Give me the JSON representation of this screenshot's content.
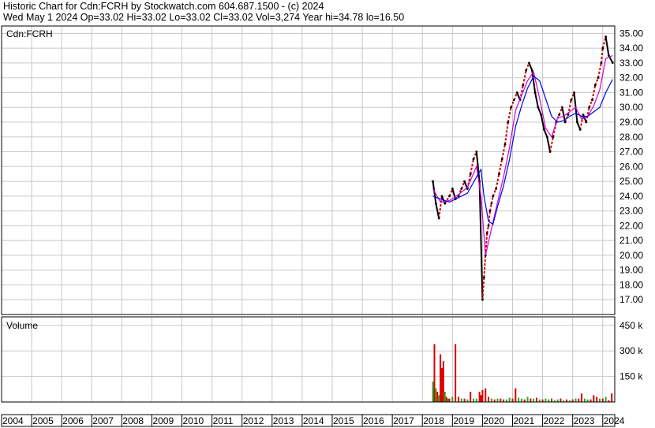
{
  "header": {
    "line1": "Historic Chart for Cdn:FCRH by Stockwatch.com 604.687.1500 - (c) 2024",
    "line2": "Wed May  1 2024   Op=33.02   Hi=33.02   Lo=33.02   Cl=33.02   Vol=3,274   Year hi=34.78   lo=16.50"
  },
  "price_panel": {
    "label": "Cdn:FCRH"
  },
  "volume_panel": {
    "label": "Volume"
  },
  "colors": {
    "grid": "#c8c8c8",
    "price_up": "#cc0000",
    "price_down": "#000000",
    "ma_short": "#d000d0",
    "ma_long": "#0000ee",
    "volume_up": "#dd0000",
    "volume_down": "#22aa22"
  },
  "chart_data": [
    {
      "type": "line",
      "title": "",
      "ylabel": "",
      "ylim": [
        16,
        35.5
      ],
      "y_ticks": [
        "17.00",
        "18.00",
        "19.00",
        "20.00",
        "21.00",
        "22.00",
        "23.00",
        "24.00",
        "25.00",
        "26.00",
        "27.00",
        "28.00",
        "29.00",
        "30.00",
        "31.00",
        "32.00",
        "33.00",
        "34.00",
        "35.00"
      ],
      "x_ticks": [
        "2004",
        "2005",
        "2006",
        "2007",
        "2008",
        "2009",
        "2010",
        "2011",
        "2012",
        "2013",
        "2014",
        "2015",
        "2016",
        "2017",
        "2018",
        "2019",
        "2020",
        "2021",
        "2022",
        "2023",
        "2024"
      ],
      "series": [
        {
          "x": [
            2018.35,
            2018.45,
            2018.55,
            2018.65,
            2018.75,
            2018.9,
            2019.0,
            2019.1,
            2019.2,
            2019.3,
            2019.4,
            2019.5,
            2019.6,
            2019.7,
            2019.8,
            2019.9,
            2020.0,
            2020.05,
            2020.1,
            2020.15,
            2020.2,
            2020.25,
            2020.3,
            2020.35,
            2020.45,
            2020.55,
            2020.65,
            2020.75,
            2020.85,
            2020.95,
            2021.05,
            2021.15,
            2021.25,
            2021.35,
            2021.45,
            2021.55,
            2021.65,
            2021.75,
            2021.85,
            2021.95,
            2022.05,
            2022.15,
            2022.25,
            2022.35,
            2022.45,
            2022.55,
            2022.65,
            2022.75,
            2022.85,
            2022.95,
            2023.05,
            2023.15,
            2023.25,
            2023.35,
            2023.45,
            2023.55,
            2023.65,
            2023.75,
            2023.85,
            2023.95,
            2024.0,
            2024.1,
            2024.2,
            2024.33
          ],
          "values": [
            25.0,
            23.5,
            22.5,
            24.0,
            23.5,
            24.0,
            24.5,
            23.8,
            24.0,
            24.5,
            25.0,
            24.5,
            25.5,
            26.5,
            27.0,
            25.0,
            17.0,
            18.5,
            20.0,
            21.5,
            22.0,
            23.0,
            23.5,
            24.0,
            24.5,
            25.5,
            26.5,
            27.5,
            29.0,
            30.0,
            30.5,
            31.0,
            30.5,
            31.5,
            32.5,
            33.0,
            32.5,
            31.0,
            30.0,
            29.5,
            28.5,
            28.0,
            27.0,
            28.0,
            29.0,
            29.5,
            30.0,
            29.0,
            29.5,
            30.5,
            31.0,
            29.0,
            28.5,
            29.5,
            29.0,
            30.0,
            30.5,
            31.5,
            32.0,
            33.0,
            34.0,
            34.78,
            33.5,
            33.02
          ]
        },
        {
          "x": [
            2018.35,
            2018.6,
            2018.9,
            2019.2,
            2019.5,
            2019.8,
            2019.95,
            2020.1,
            2020.3,
            2020.5,
            2020.7,
            2020.9,
            2021.1,
            2021.3,
            2021.5,
            2021.7,
            2021.9,
            2022.1,
            2022.3,
            2022.5,
            2022.7,
            2022.9,
            2023.1,
            2023.3,
            2023.5,
            2023.7,
            2023.9,
            2024.1,
            2024.33
          ],
          "values": [
            24.5,
            23.6,
            23.7,
            24.1,
            24.6,
            26.0,
            24.0,
            20.0,
            21.8,
            23.6,
            25.3,
            27.3,
            29.8,
            30.8,
            31.8,
            32.4,
            30.6,
            28.6,
            28.0,
            29.3,
            29.4,
            29.7,
            30.0,
            29.2,
            29.4,
            30.1,
            31.2,
            33.3,
            33.5
          ]
        },
        {
          "x": [
            2018.35,
            2018.6,
            2018.9,
            2019.2,
            2019.5,
            2019.8,
            2019.95,
            2020.05,
            2020.2,
            2020.35,
            2020.5,
            2020.7,
            2020.9,
            2021.1,
            2021.3,
            2021.5,
            2021.7,
            2021.9,
            2022.1,
            2022.3,
            2022.5,
            2022.7,
            2022.9,
            2023.1,
            2023.3,
            2023.5,
            2023.7,
            2023.9,
            2024.1,
            2024.33
          ],
          "values": [
            24.0,
            23.8,
            23.6,
            23.9,
            24.2,
            25.3,
            25.8,
            24.0,
            22.3,
            22.1,
            23.3,
            24.7,
            26.5,
            28.7,
            30.1,
            31.3,
            32.1,
            31.8,
            30.6,
            29.4,
            29.0,
            29.1,
            29.4,
            29.6,
            29.4,
            29.4,
            29.7,
            30.0,
            31.0,
            31.9
          ]
        }
      ]
    },
    {
      "type": "bar",
      "title": "",
      "ylabel": "",
      "ylim": [
        0,
        500000
      ],
      "y_ticks": [
        "150 k",
        "300 k",
        "450 k"
      ],
      "x": [
        2018.35,
        2018.4,
        2018.45,
        2018.5,
        2018.55,
        2018.6,
        2018.65,
        2018.7,
        2018.75,
        2018.8,
        2018.85,
        2018.9,
        2019.0,
        2019.1,
        2019.2,
        2019.3,
        2019.4,
        2019.5,
        2019.6,
        2019.7,
        2019.8,
        2019.9,
        2019.95,
        2020.0,
        2020.1,
        2020.2,
        2020.3,
        2020.4,
        2020.5,
        2020.6,
        2020.7,
        2020.8,
        2020.9,
        2021.0,
        2021.1,
        2021.2,
        2021.3,
        2021.4,
        2021.5,
        2021.6,
        2021.7,
        2021.8,
        2021.9,
        2022.0,
        2022.1,
        2022.2,
        2022.3,
        2022.4,
        2022.5,
        2022.6,
        2022.7,
        2022.8,
        2022.9,
        2023.0,
        2023.1,
        2023.2,
        2023.3,
        2023.4,
        2023.5,
        2023.6,
        2023.7,
        2023.8,
        2023.9,
        2024.0,
        2024.1,
        2024.2,
        2024.3
      ],
      "values": [
        120000,
        340000,
        80000,
        60000,
        40000,
        280000,
        200000,
        240000,
        60000,
        30000,
        20000,
        20000,
        30000,
        340000,
        30000,
        20000,
        20000,
        15000,
        60000,
        20000,
        20000,
        60000,
        40000,
        70000,
        80000,
        30000,
        20000,
        15000,
        20000,
        20000,
        15000,
        15000,
        25000,
        20000,
        80000,
        25000,
        20000,
        15000,
        30000,
        20000,
        20000,
        25000,
        15000,
        15000,
        20000,
        15000,
        20000,
        10000,
        15000,
        20000,
        10000,
        15000,
        10000,
        15000,
        20000,
        20000,
        50000,
        20000,
        15000,
        15000,
        40000,
        30000,
        20000,
        20000,
        30000,
        10000,
        50000
      ],
      "up": [
        false,
        true,
        false,
        true,
        false,
        true,
        true,
        true,
        false,
        true,
        false,
        true,
        false,
        true,
        true,
        false,
        true,
        false,
        true,
        false,
        false,
        true,
        true,
        true,
        true,
        true,
        false,
        true,
        false,
        true,
        true,
        false,
        false,
        true,
        true,
        false,
        false,
        true,
        false,
        true,
        false,
        true,
        false,
        true,
        false,
        false,
        true,
        false,
        false,
        true,
        false,
        true,
        false,
        true,
        false,
        true,
        true,
        false,
        false,
        true,
        true,
        true,
        false,
        true,
        false,
        true,
        true
      ]
    }
  ]
}
